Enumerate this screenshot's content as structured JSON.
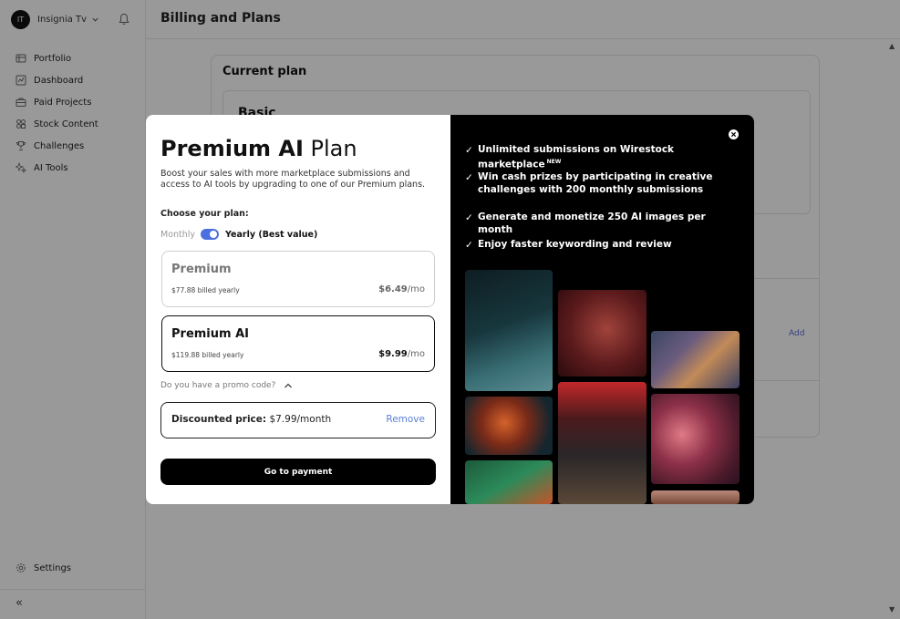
{
  "sidebar": {
    "workspace": {
      "initials": "IT",
      "name": "Insignia Tv"
    },
    "items": [
      {
        "label": "Portfolio",
        "icon": "portfolio-icon"
      },
      {
        "label": "Dashboard",
        "icon": "dashboard-icon"
      },
      {
        "label": "Paid Projects",
        "icon": "briefcase-icon"
      },
      {
        "label": "Stock Content",
        "icon": "stock-content-icon"
      },
      {
        "label": "Challenges",
        "icon": "trophy-icon"
      },
      {
        "label": "AI Tools",
        "icon": "sparkle-icon"
      }
    ],
    "settings_label": "Settings",
    "collapse_glyph": "«"
  },
  "header": {
    "title": "Billing and Plans"
  },
  "main": {
    "card_title": "Current plan",
    "current_plan_name": "Basic",
    "add_label": "Add"
  },
  "modal": {
    "title_bold": "Premium AI",
    "title_rest": " Plan",
    "description": "Boost your sales with more marketplace submissions and access to AI tools by upgrading to one of our Premium plans.",
    "choose_label": "Choose your plan:",
    "toggle": {
      "left_label": "Monthly",
      "right_label": "Yearly (Best value)",
      "selected": "Yearly"
    },
    "plans": [
      {
        "name": "Premium",
        "billed": "$77.88 billed yearly",
        "price": "$6.49",
        "per": "/mo",
        "selected": false
      },
      {
        "name": "Premium AI",
        "billed": "$119.88 billed yearly",
        "price": "$9.99",
        "per": "/mo",
        "selected": true
      }
    ],
    "promo_label": "Do you have a promo code?",
    "discount": {
      "label": "Discounted price:",
      "value": " $7.99/month",
      "remove_label": "Remove"
    },
    "pay_button": "Go to payment",
    "features": [
      {
        "text": "Unlimited submissions on Wirestock marketplace",
        "badge": "NEW"
      },
      {
        "text": "Win cash prizes by participating in creative challenges with 200 monthly submissions"
      },
      {
        "text": "Generate and monetize 250 AI images per month"
      },
      {
        "text": "Enjoy faster keywording and review"
      }
    ],
    "check_glyph": "✓"
  },
  "colors": {
    "accent": "#4c6fe0",
    "remove_link": "#5b7fd6",
    "overlay": "rgba(0,0,0,0.40)"
  }
}
